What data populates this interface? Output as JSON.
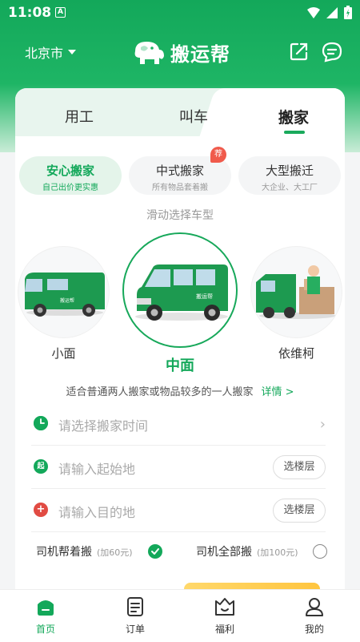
{
  "status_bar": {
    "time": "11:08",
    "notification_icon": "a-icon"
  },
  "header": {
    "city": "北京市",
    "logo_text": "搬运帮",
    "share_icon": "share-icon",
    "message_icon": "message-icon"
  },
  "tabs": [
    {
      "label": "用工",
      "active": false
    },
    {
      "label": "叫车",
      "active": false
    },
    {
      "label": "搬家",
      "active": true
    }
  ],
  "service_types": [
    {
      "title": "安心搬家",
      "subtitle": "自己出价更实惠",
      "active": true
    },
    {
      "title": "中式搬家",
      "subtitle": "所有物品套着搬",
      "badge": "荐",
      "active": false
    },
    {
      "title": "大型搬迁",
      "subtitle": "大企业、大工厂",
      "active": false
    }
  ],
  "swipe_hint": "滑动选择车型",
  "vehicles": [
    {
      "label": "小面",
      "selected": false
    },
    {
      "label": "中面",
      "selected": true
    },
    {
      "label": "依维柯",
      "selected": false
    }
  ],
  "vehicle_desc": {
    "text": "适合普通两人搬家或物品较多的一人搬家",
    "detail_link": "详情 >"
  },
  "form": {
    "time_placeholder": "请选择搬家时间",
    "start_placeholder": "请输入起始地",
    "start_icon_text": "起",
    "end_placeholder": "请输入目的地",
    "floor_button": "选楼层"
  },
  "options": [
    {
      "label": "司机帮着搬",
      "note": "(加60元)",
      "checked": true
    },
    {
      "label": "司机全部搬",
      "note": "(加100元)",
      "checked": false
    }
  ],
  "colors": {
    "brand_green": "#13a85a",
    "badge_red": "#f05a4b",
    "end_red": "#e14b43"
  },
  "bottom_nav": [
    {
      "label": "首页",
      "icon": "home-icon",
      "active": true
    },
    {
      "label": "订单",
      "icon": "order-icon",
      "active": false
    },
    {
      "label": "福利",
      "icon": "welfare-icon",
      "active": false
    },
    {
      "label": "我的",
      "icon": "profile-icon",
      "active": false
    }
  ]
}
